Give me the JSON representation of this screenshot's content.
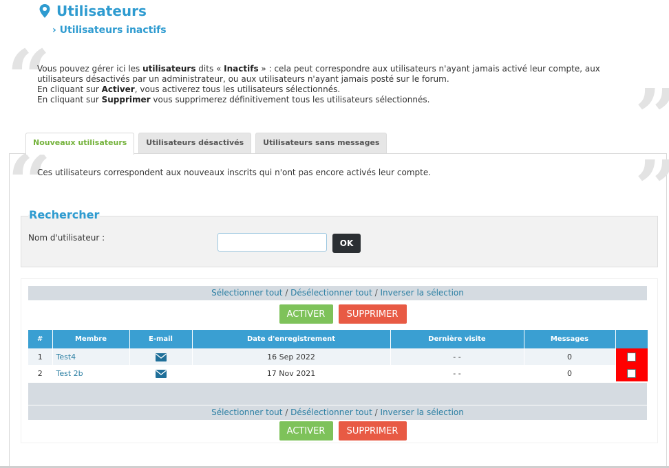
{
  "header": {
    "title": "Utilisateurs",
    "breadcrumb": "› Utilisateurs inactifs"
  },
  "intro": {
    "line1_a": "Vous pouvez gérer ici les ",
    "line1_b": "utilisateurs",
    "line1_c": " dits « ",
    "line1_d": "Inactifs",
    "line1_e": " » : cela peut correspondre aux utilisateurs n'ayant jamais activé leur compte, aux utilisateurs désactivés par un administrateur, ou aux utilisateurs n'ayant jamais posté sur le forum.",
    "line2_a": "En cliquant sur ",
    "line2_b": "Activer",
    "line2_c": ", vous activerez tous les utilisateurs sélectionnés.",
    "line3_a": "En cliquant sur ",
    "line3_b": "Supprimer",
    "line3_c": " vous supprimerez définitivement tous les utilisateurs sélectionnés."
  },
  "tabs": [
    {
      "label": "Nouveaux utilisateurs",
      "active": true
    },
    {
      "label": "Utilisateurs désactivés",
      "active": false
    },
    {
      "label": "Utilisateurs sans messages",
      "active": false
    }
  ],
  "panel": {
    "description": "Ces utilisateurs correspondent aux nouveaux inscrits qui n'ont pas encore activés leur compte."
  },
  "search": {
    "legend": "Rechercher",
    "username_label": "Nom d'utilisateur :",
    "username_value": "",
    "ok_label": "OK"
  },
  "selection": {
    "select_all": "Sélectionner tout",
    "deselect_all": "Désélectionner tout",
    "invert": "Inverser la sélection",
    "separator": " / "
  },
  "actions": {
    "activate_label": "ACTIVER",
    "delete_label": "SUPPRIMER"
  },
  "table": {
    "columns": [
      "#",
      "Membre",
      "E-mail",
      "Date d'enregistrement",
      "Dernière visite",
      "Messages",
      ""
    ],
    "rows": [
      {
        "num": "1",
        "member": "Test4",
        "registered": "16 Sep 2022",
        "last_visit": "- -",
        "messages": "0"
      },
      {
        "num": "2",
        "member": "Test 2b",
        "registered": "17 Nov 2021",
        "last_visit": "- -",
        "messages": "0"
      }
    ]
  },
  "colors": {
    "accent": "#2e9bd0",
    "tab_active": "#74b23b",
    "activate": "#7ec25a",
    "delete": "#e85a44",
    "table_header": "#3a9fd2",
    "checkbox_cell": "#ff0000"
  },
  "icons": {
    "title": "map-pin-icon",
    "email": "envelope-icon"
  }
}
